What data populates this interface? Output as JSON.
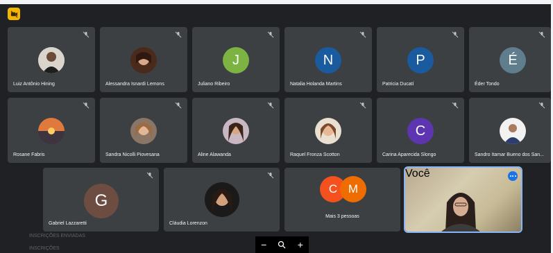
{
  "participants_row1": [
    {
      "name": "Luiz Antônio Hining",
      "type": "photo"
    },
    {
      "name": "Alessandra Isnardi Lemons",
      "type": "photo"
    },
    {
      "name": "Juliano Ribeiro",
      "initial": "J",
      "color": "#7cb342"
    },
    {
      "name": "Natalia Holanda Martins",
      "initial": "N",
      "color": "#1a5a9e"
    },
    {
      "name": "Patricia Ducatí",
      "initial": "P",
      "color": "#1a5a9e"
    },
    {
      "name": "Éder Tondo",
      "initial": "É",
      "color": "#5f7d8c"
    }
  ],
  "participants_row2": [
    {
      "name": "Rosane Fabris",
      "type": "photo"
    },
    {
      "name": "Sandra Nicolli Piovesana",
      "type": "photo"
    },
    {
      "name": "Aline Alawanda",
      "type": "photo"
    },
    {
      "name": "Raquel Fronza Scotton",
      "type": "photo"
    },
    {
      "name": "Carina Aparecida Slongo",
      "initial": "C",
      "color": "#5e35b1"
    },
    {
      "name": "Sandro Itamar Bueno dos San...",
      "type": "photo"
    }
  ],
  "participants_row3": [
    {
      "name": "Gabriel Lazzaretti",
      "initial": "G",
      "color": "#6d4c41"
    },
    {
      "name": "Cláudia Lorenzon",
      "type": "photo"
    }
  ],
  "more": {
    "label": "Mais 3 pessoas",
    "initials": [
      "C",
      "M"
    ],
    "colors": [
      "#f4511e",
      "#ef6c00"
    ]
  },
  "self": {
    "name": "Você"
  },
  "zoom": {
    "minus": "−",
    "icon": "search-icon",
    "plus": "+"
  },
  "bg_lines": [
    "INSCRIÇÕES ENVIADAS",
    "INSCRIÇÕES"
  ]
}
